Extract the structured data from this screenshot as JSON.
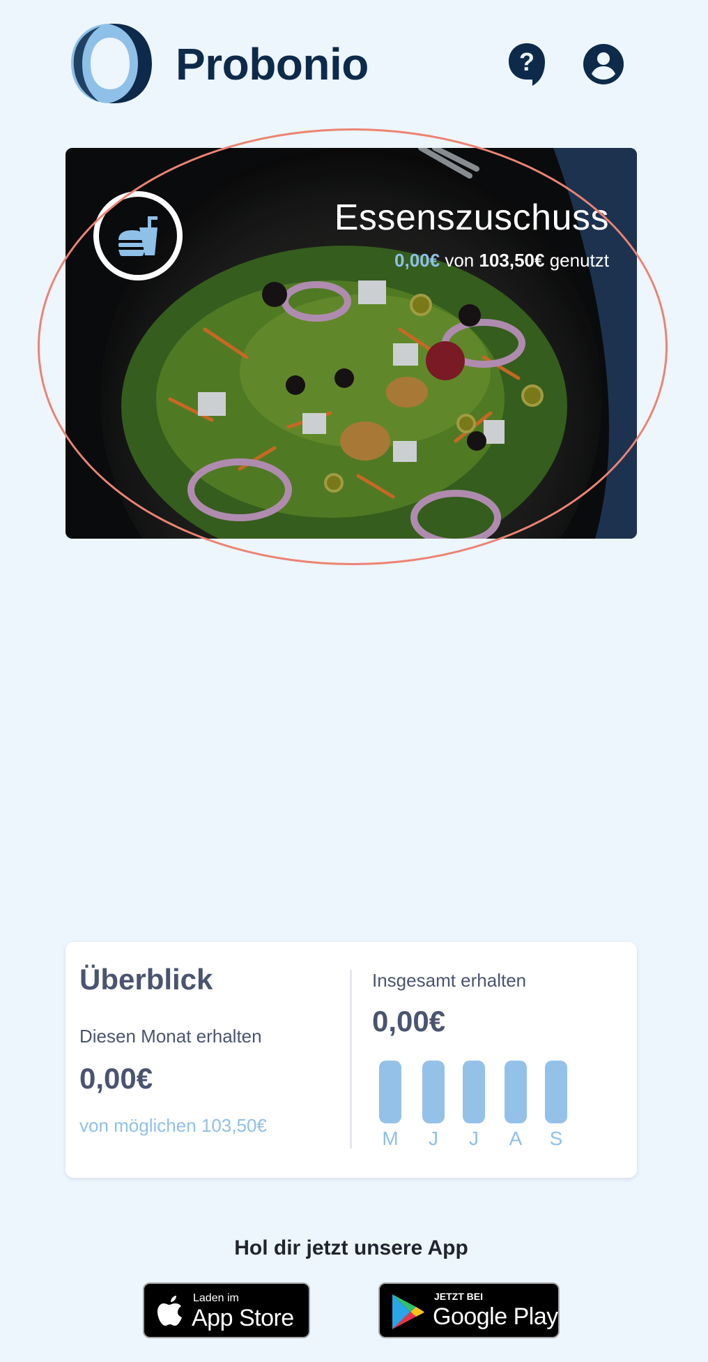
{
  "header": {
    "brand": "Probonio",
    "help_icon": "help-bubble-icon",
    "account_icon": "account-circle-icon",
    "brand_color": "#0d2a4a",
    "logo_light_color": "#8fc0e8"
  },
  "benefit_card": {
    "title": "Essenszuschuss",
    "used_amount": "0,00€",
    "word_of": "von",
    "max_amount": "103,50€",
    "word_used": "genutzt",
    "icon": "fastfood-icon",
    "accent_color": "#8fc0e8"
  },
  "overview": {
    "title": "Überblick",
    "month_label": "Diesen Monat erhalten",
    "month_value": "0,00€",
    "possible_label": "von möglichen 103,50€",
    "total_label": "Insgesamt erhalten",
    "total_value": "0,00€",
    "months": [
      {
        "label": "M",
        "value": 0
      },
      {
        "label": "J",
        "value": 0
      },
      {
        "label": "J",
        "value": 0
      },
      {
        "label": "A",
        "value": 0
      },
      {
        "label": "S",
        "value": 0
      }
    ],
    "bar_color": "#94c1e8"
  },
  "app_promo": {
    "title": "Hol dir jetzt unsere App",
    "appstore_small": "Laden im",
    "appstore_big": "App Store",
    "gplay_small": "JETZT BEI",
    "gplay_big": "Google Play"
  },
  "highlight_color": "#ec8373"
}
